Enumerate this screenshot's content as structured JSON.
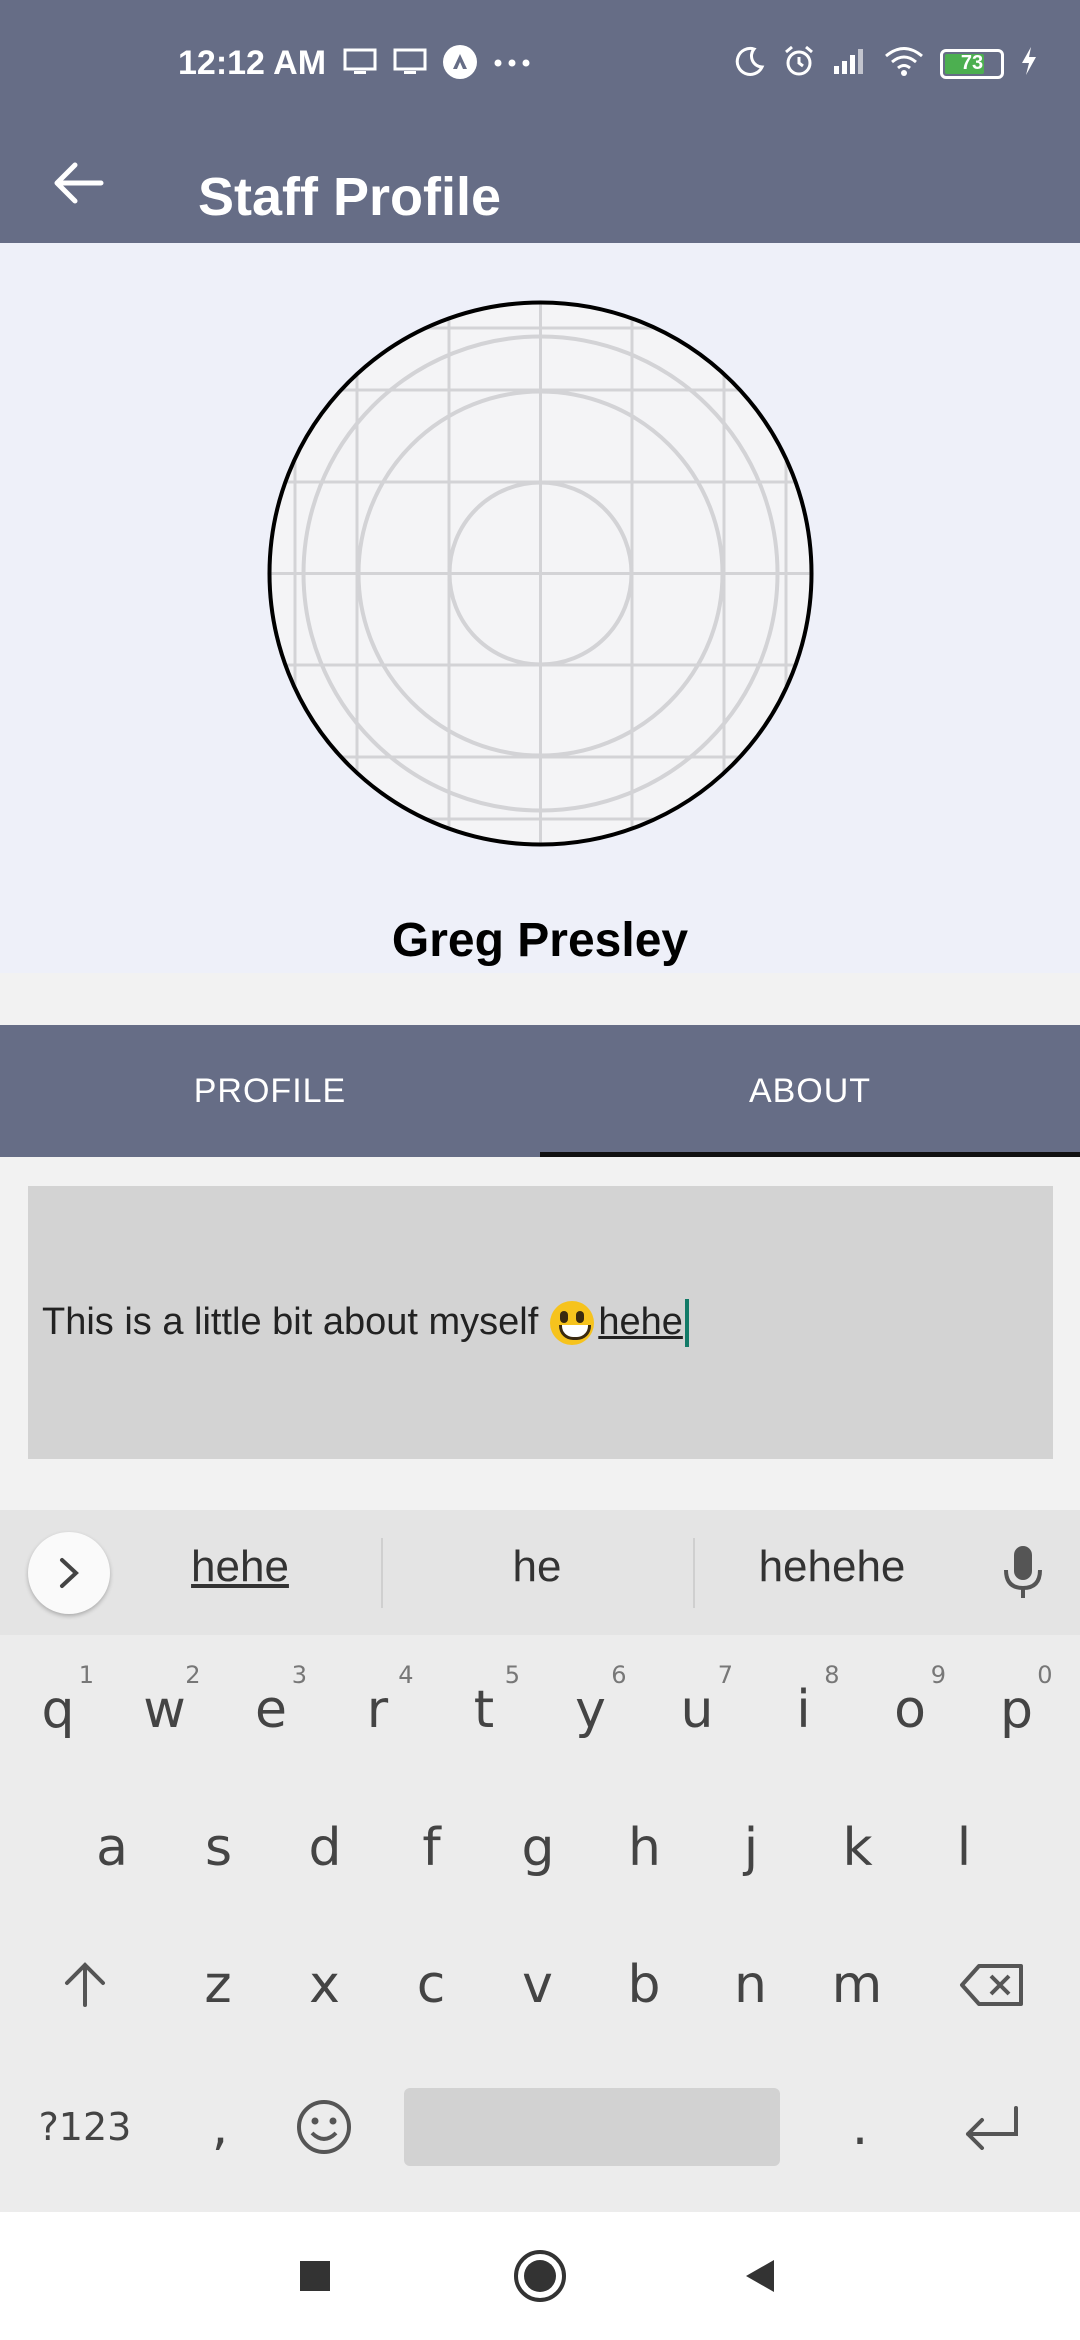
{
  "status_bar": {
    "time": "12:12 AM",
    "battery_level": "73",
    "icons_left": [
      "monitor-icon",
      "monitor-icon",
      "app-notification-icon",
      "more-dots-icon"
    ],
    "icons_right": [
      "moon-icon",
      "alarm-icon",
      "signal-icon",
      "wifi-icon",
      "battery-icon",
      "charging-icon"
    ]
  },
  "app_bar": {
    "title": "Staff Profile",
    "back_icon": "arrow-left-icon"
  },
  "profile": {
    "name": "Greg Presley",
    "avatar_icon": "placeholder-circle-icon"
  },
  "tabs": [
    {
      "label": "PROFILE",
      "active": false
    },
    {
      "label": "ABOUT",
      "active": true
    }
  ],
  "about": {
    "text": "This is a little bit about myself ",
    "composing": "hehe"
  },
  "keyboard": {
    "suggestions": [
      "hehe",
      "he",
      "hehehe"
    ],
    "row1": [
      "q",
      "w",
      "e",
      "r",
      "t",
      "y",
      "u",
      "i",
      "o",
      "p"
    ],
    "row1_hints": [
      "1",
      "2",
      "3",
      "4",
      "5",
      "6",
      "7",
      "8",
      "9",
      "0"
    ],
    "row2": [
      "a",
      "s",
      "d",
      "f",
      "g",
      "h",
      "j",
      "k",
      "l"
    ],
    "row3": [
      "z",
      "x",
      "c",
      "v",
      "b",
      "n",
      "m"
    ],
    "symbols_label": "?123",
    "comma": ",",
    "period": "."
  },
  "colors": {
    "primary": "#666d86",
    "header_bg": "#eef0f9",
    "input_bg": "#d3d3d3",
    "caret": "#127a67"
  }
}
